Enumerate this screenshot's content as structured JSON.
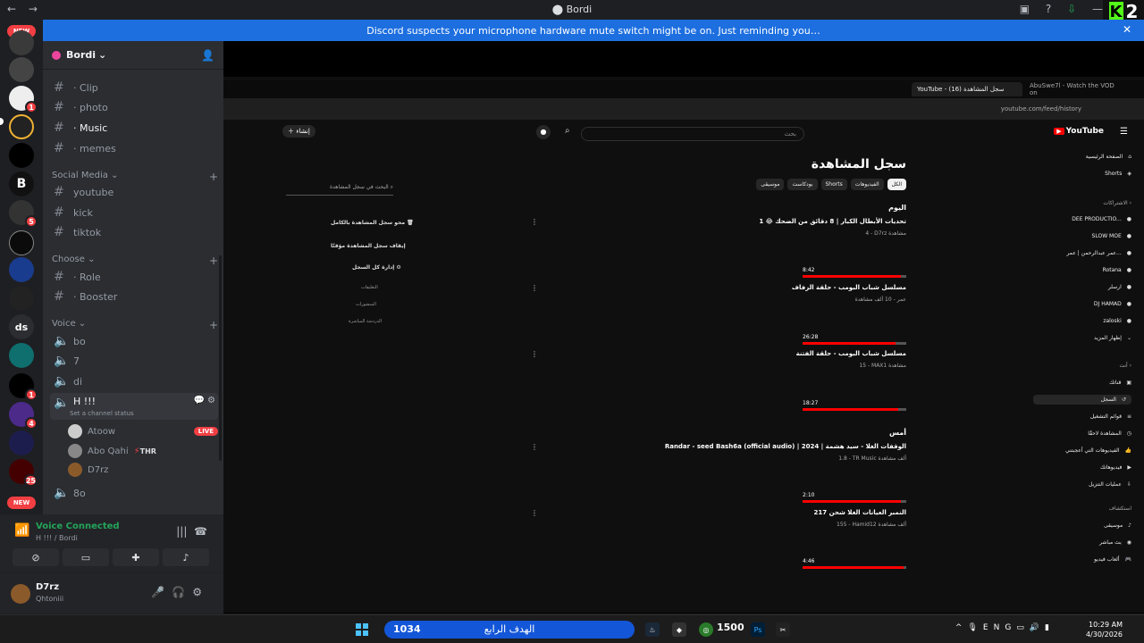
{
  "window": {
    "title": "Bordi",
    "nav_back": "←",
    "nav_fwd": "→",
    "notice": "Discord suspects your microphone hardware mute switch might be on. Just reminding you…",
    "notice_close": "✕",
    "overlay_badge": "2"
  },
  "guilds": {
    "new_badge": "NEW",
    "items": [
      {
        "label": "",
        "badge": ""
      },
      {
        "label": "",
        "badge": ""
      },
      {
        "label": "",
        "badge": "1"
      },
      {
        "label": "",
        "badge": ""
      },
      {
        "label": "",
        "badge": ""
      },
      {
        "label": "",
        "badge": ""
      },
      {
        "label": "",
        "badge": "5"
      },
      {
        "label": "",
        "badge": ""
      },
      {
        "label": "",
        "badge": ""
      },
      {
        "label": "",
        "badge": ""
      },
      {
        "label": "ds",
        "badge": ""
      },
      {
        "label": "",
        "badge": ""
      },
      {
        "label": "",
        "badge": "1"
      },
      {
        "label": "",
        "badge": "4"
      },
      {
        "label": "",
        "badge": ""
      },
      {
        "label": "",
        "badge": "25"
      }
    ]
  },
  "server": {
    "name": "Bordi"
  },
  "channels": {
    "text_top": [
      {
        "label": "· Clip"
      },
      {
        "label": "· photo"
      },
      {
        "label": "· Music"
      },
      {
        "label": "· memes"
      }
    ],
    "social_media": {
      "label": "Social Media",
      "items": [
        {
          "label": "youtube"
        },
        {
          "label": "kick"
        },
        {
          "label": "tiktok"
        }
      ]
    },
    "choose": {
      "label": "Choose",
      "items": [
        {
          "label": "· Role"
        },
        {
          "label": "· Booster"
        }
      ]
    },
    "voice": {
      "label": "Voice",
      "items": [
        {
          "label": "bo"
        },
        {
          "label": "7"
        },
        {
          "label": "di"
        }
      ],
      "active": {
        "label": "H !!!",
        "status": "Set a channel status"
      },
      "users": [
        {
          "name": "Atoow",
          "live": "LIVE"
        },
        {
          "name": "Abo Qahi",
          "tag": "THR"
        },
        {
          "name": "D7rz"
        }
      ],
      "after": {
        "label": "8o"
      }
    }
  },
  "voice_panel": {
    "status": "Voice Connected",
    "channel": "H !!! / Bordi"
  },
  "user": {
    "name": "D7rz",
    "status": "Qhtoniii"
  },
  "browser": {
    "tab1": "YouTube - سجل المشاهدة (16)",
    "tab2": "AbuSwe7l - Watch the VOD on",
    "url": "youtube.com/feed/history"
  },
  "youtube": {
    "logo": "YouTube",
    "search_placeholder": "بحث",
    "create": "إنشاء",
    "title": "سجل المشاهدة",
    "chips": [
      "الكل",
      "الفيديوهات",
      "Shorts",
      "بودكاست",
      "موسيقى"
    ],
    "day_today": "اليوم",
    "day_yesterday": "أمس",
    "videos": [
      {
        "title": "تحديات الأبطال الكبار | 8 دقائق من الضحك 😂 1",
        "meta": "4 - D7rz مشاهدة",
        "duration": "8:42",
        "progress": 0.95
      },
      {
        "title": "مسلسل شباب البومب - حلقة الزفاف",
        "meta": "عمر - 10 ألف مشاهدة",
        "duration": "26:28",
        "progress": 0.9
      },
      {
        "title": "مسلسل شباب البومب - حلقة الفتنة",
        "meta": "15 - MAX1 مشاهدة",
        "duration": "18:27",
        "progress": 0.92
      },
      {
        "title": "Randar - seed Bash6a (official audio) | الوقفات الغلا - سيد هشمة | 2024",
        "meta": "1.8 - TR Music ألف مشاهدة",
        "duration": "2:10",
        "progress": 0.95
      },
      {
        "title": "217 النمبر العيانات الغلا شحن",
        "meta": "155 - Hamid12 ألف مشاهدة",
        "duration": "4:46",
        "progress": 0.97
      }
    ],
    "history_search": "البحث في سجل المشاهدة",
    "actions": [
      "محو سجل المشاهدة بالكامل",
      "إيقاف سجل المشاهدة مؤقتًا",
      "إدارة كل السجل"
    ],
    "sub_actions": [
      "التعليقات",
      "المنشورات",
      "الدردشة المباشرة"
    ],
    "guide_top": [
      "الصفحة الرئيسية",
      "Shorts"
    ],
    "subs_label": "الاشتراكات",
    "subs": [
      "DEE PRODUCTIO...",
      "SLOW MOE",
      "عمر عبدالرحمن | عمر...",
      "Rotana",
      "ارسلر",
      "DJ HAMAD",
      "zaloski",
      "إظهار المزيد"
    ],
    "you_label": "أنت",
    "you": [
      "قناتك",
      "السجل",
      "قوائم التشغيل",
      "المشاهدة لاحقًا",
      "الفيديوهات التي أعجبتني",
      "فيديوهاتك",
      "عمليات التنزيل"
    ],
    "explore_label": "استكشاف",
    "explore": [
      "موسيقى",
      "بث مباشر",
      "ألعاب فيديو"
    ]
  },
  "taskbar": {
    "left_value": "1034",
    "search_text": "الهدف الرابع",
    "right_value": "1500",
    "lang": "ENG",
    "time": "10:29 AM",
    "date": "4/30/2026"
  }
}
